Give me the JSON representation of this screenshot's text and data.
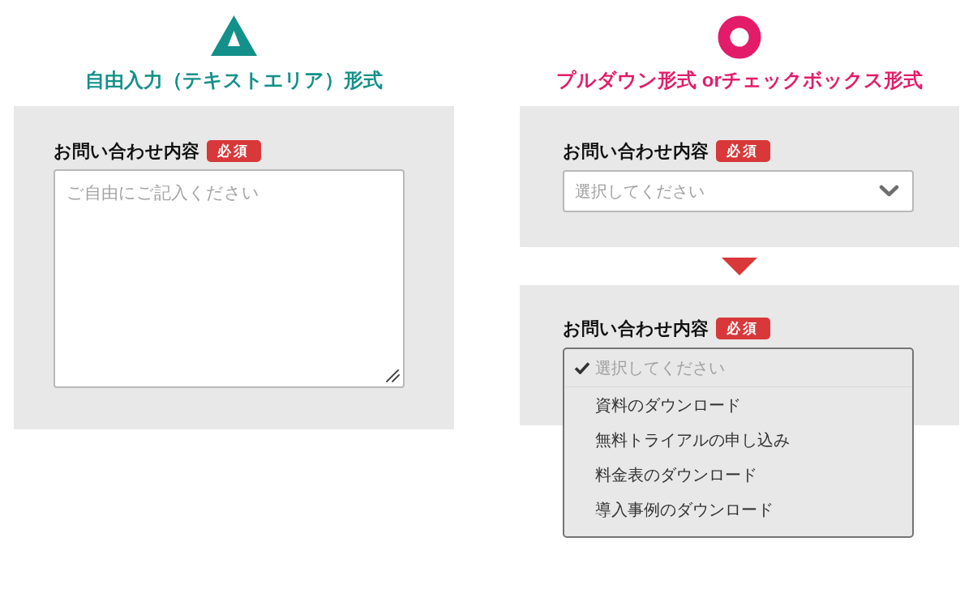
{
  "columns": [
    {
      "kind": "triangle",
      "heading": "自由入力（テキストエリア）形式",
      "color": "#139089",
      "forms": [
        {
          "label": "お問い合わせ内容",
          "badge": "必須",
          "field": {
            "kind": "textarea",
            "placeholder": "ご自由にご記入ください"
          }
        }
      ]
    },
    {
      "kind": "circle",
      "heading": "プルダウン形式 orチェックボックス形式",
      "color": "#e31c6a",
      "forms": [
        {
          "label": "お問い合わせ内容",
          "badge": "必須",
          "field": {
            "kind": "select",
            "placeholder": "選択してください",
            "expanded": false
          }
        },
        {
          "label": "お問い合わせ内容",
          "badge": "必須",
          "field": {
            "kind": "select",
            "expanded": true,
            "options": [
              {
                "text": "選択してください",
                "selected": true,
                "disabled": true
              },
              {
                "text": "資料のダウンロード",
                "selected": false,
                "disabled": false
              },
              {
                "text": "無料トライアルの申し込み",
                "selected": false,
                "disabled": false
              },
              {
                "text": "料金表のダウンロード",
                "selected": false,
                "disabled": false
              },
              {
                "text": "導入事例のダウンロード",
                "selected": false,
                "disabled": false
              }
            ]
          }
        }
      ]
    }
  ]
}
